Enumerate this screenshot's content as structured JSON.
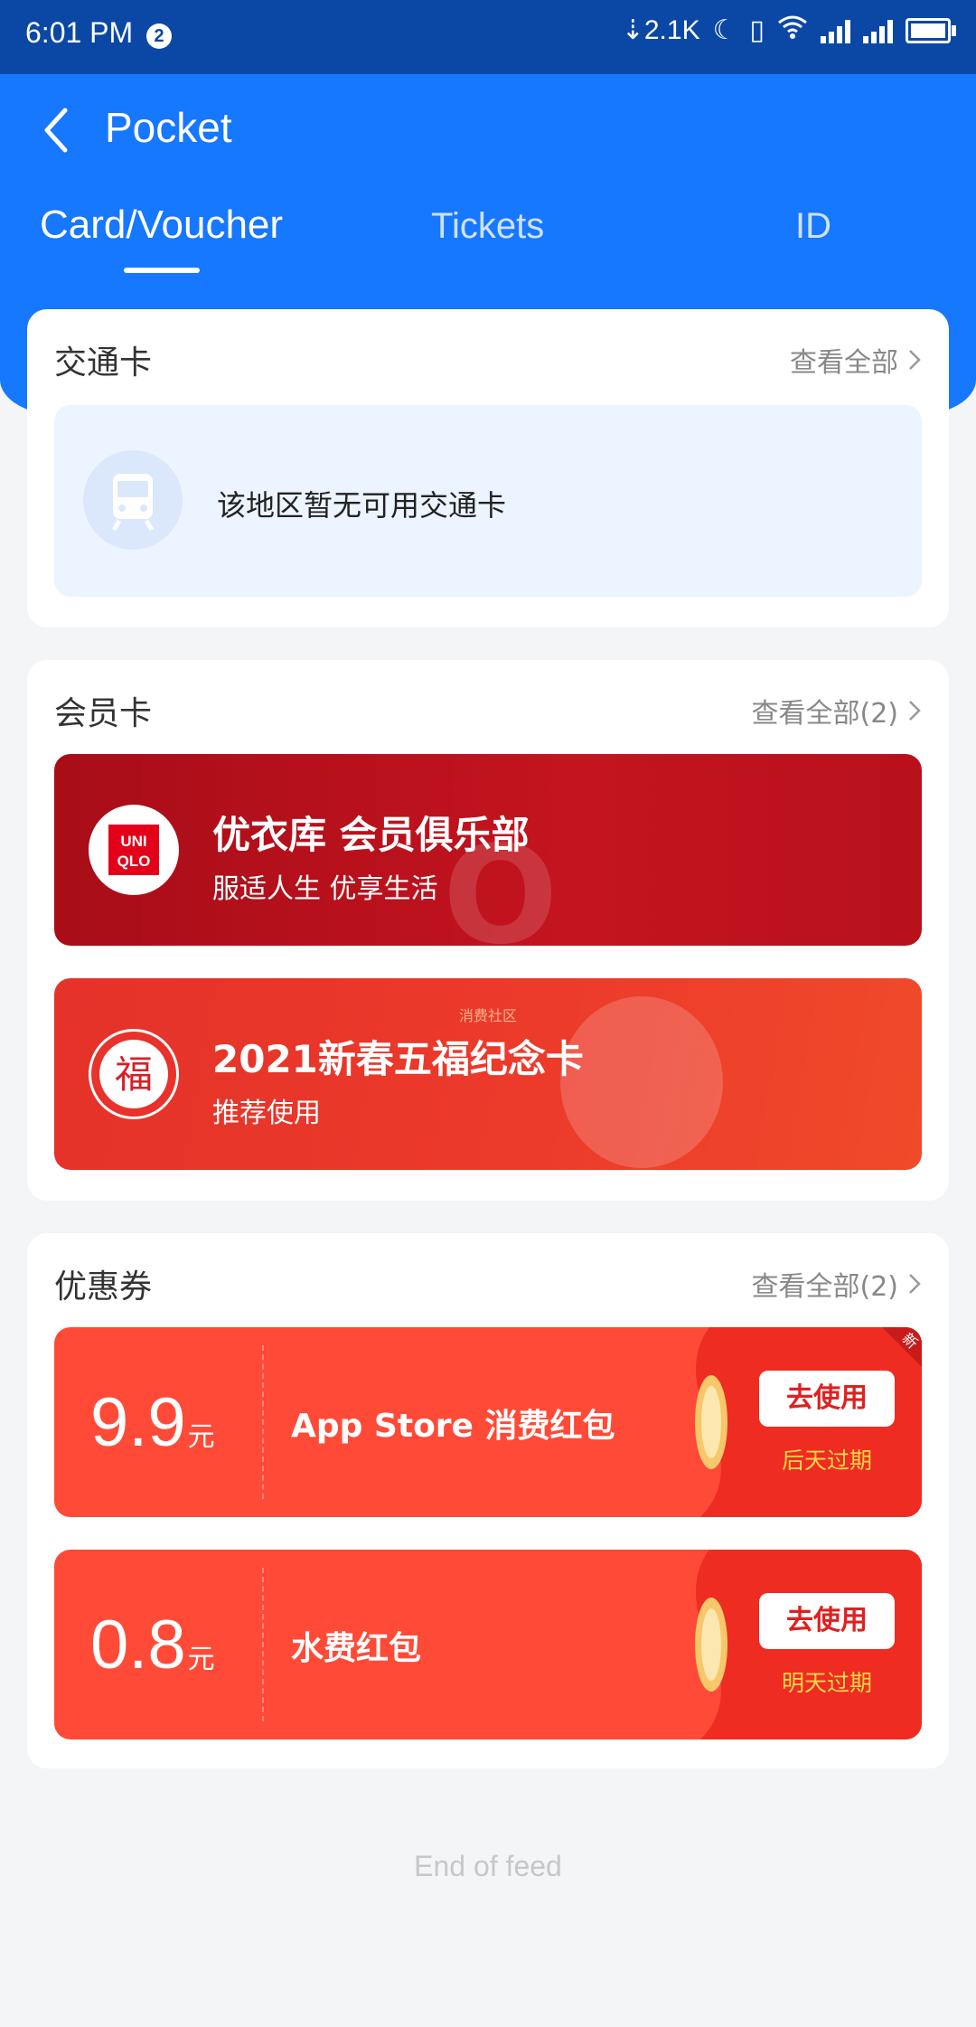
{
  "status_bar": {
    "time": "6:01 PM",
    "badge": "2",
    "net_speed": "2.1K"
  },
  "header": {
    "title": "Pocket"
  },
  "tabs": [
    {
      "label": "Card/Voucher",
      "active": true
    },
    {
      "label": "Tickets",
      "active": false
    },
    {
      "label": "ID",
      "active": false
    }
  ],
  "transit": {
    "title": "交通卡",
    "link": "查看全部",
    "empty_message": "该地区暂无可用交通卡"
  },
  "membership": {
    "title": "会员卡",
    "link": "查看全部(2)",
    "cards": [
      {
        "name": "优衣库 会员俱乐部",
        "subtitle": "服适人生 优享生活",
        "logo_text": "UNI QLO",
        "bg_text": "O MEM"
      },
      {
        "name": "2021新春五福纪念卡",
        "subtitle": "推荐使用",
        "logo_text": "福",
        "tag": "消费社区"
      }
    ]
  },
  "coupons": {
    "title": "优惠券",
    "link": "查看全部(2)",
    "items": [
      {
        "amount": "9.9",
        "unit": "元",
        "name": "App Store 消费红包",
        "button": "去使用",
        "expiry": "后天过期",
        "new_tag": "新"
      },
      {
        "amount": "0.8",
        "unit": "元",
        "name": "水费红包",
        "button": "去使用",
        "expiry": "明天过期"
      }
    ]
  },
  "footer": {
    "end_text": "End of feed"
  },
  "colors": {
    "primary": "#1677ff",
    "status_bar": "#0b48a6",
    "coupon": "#ff4a37",
    "uniqlo": "#b5111e"
  }
}
